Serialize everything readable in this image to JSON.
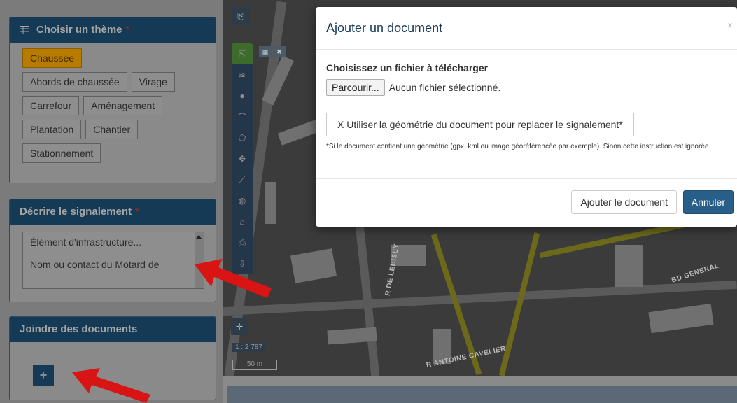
{
  "theme_panel": {
    "title": "Choisir un thème",
    "required_mark": "*",
    "rows": [
      [
        "Chaussée"
      ],
      [
        "Abords de chaussée",
        "Virage"
      ],
      [
        "Carrefour",
        "Aménagement"
      ],
      [
        "Plantation",
        "Chantier"
      ],
      [
        "Stationnement"
      ]
    ],
    "selected": "Chaussée"
  },
  "describe_panel": {
    "title": "Décrire le signalement",
    "required_mark": "*",
    "line1": "Élément d'infrastructure...",
    "line2": "Nom ou contact du Motard de"
  },
  "docs_panel": {
    "title": "Joindre des documents",
    "add_label": "+"
  },
  "map": {
    "scale_text": "1 : 2 787",
    "scale_bar": "50 m",
    "street_labels": [
      "R DE LEBISEY",
      "R ANTOINE CAVELIER",
      "BD GENERAL"
    ]
  },
  "modal": {
    "title": "Ajouter un document",
    "close": "×",
    "choose_label": "Choisissez un fichier à télécharger",
    "browse_button": "Parcourir...",
    "file_status": "Aucun fichier sélectionné.",
    "geometry_button": "X Utiliser la géométrie du document pour replacer le signalement*",
    "note": "*Si le document contient une géométrie (gpx, kml ou image géoréférencée par exemple). Sinon cette instruction est ignorée.",
    "add_button": "Ajouter le document",
    "cancel_button": "Annuler"
  },
  "colors": {
    "panel_header": "#143a56",
    "selected_theme": "#b77b00",
    "cancel_button": "#285e88",
    "arrow": "#d81414"
  }
}
